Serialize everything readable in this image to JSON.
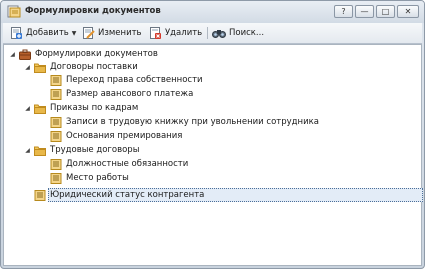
{
  "window": {
    "title": "Формулировки документов",
    "buttons": {
      "help": "?",
      "minimize": "—",
      "maximize": "□",
      "close": "✕"
    }
  },
  "toolbar": {
    "add_label": "Добавить",
    "edit_label": "Изменить",
    "delete_label": "Удалить",
    "search_label": "Поиск..."
  },
  "tree": {
    "root": "Формулировки документов",
    "groups": [
      {
        "label": "Договоры поставки",
        "items": [
          "Переход права собственности",
          "Размер авансового платежа"
        ]
      },
      {
        "label": "Приказы по кадрам",
        "items": [
          "Записи в трудовую книжку при увольнении сотрудника",
          "Основания премирования"
        ]
      },
      {
        "label": "Трудовые договоры",
        "items": [
          "Должностные обязанности",
          "Место работы"
        ]
      }
    ],
    "loose_item": "Юридический статус контрагента"
  },
  "colors": {
    "folder": "#e8b84a",
    "selection_border": "#4c6f99",
    "add_icon": "#3a7bd5",
    "delete_icon": "#d33a2c"
  }
}
